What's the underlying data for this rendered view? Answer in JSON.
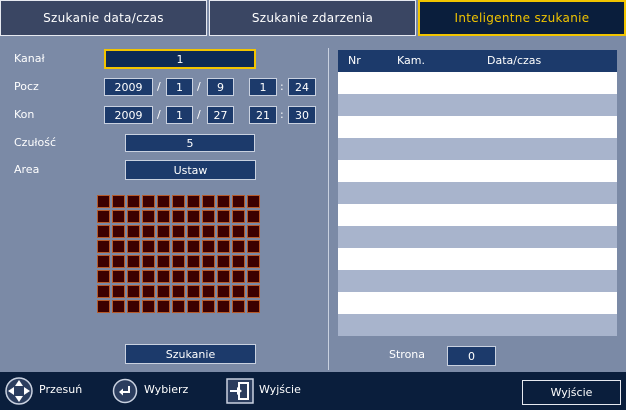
{
  "tabs": [
    {
      "label": "Szukanie data/czas",
      "active": false
    },
    {
      "label": "Szukanie zdarzenia",
      "active": false
    },
    {
      "label": "Inteligentne szukanie",
      "active": true
    }
  ],
  "form": {
    "channel_label": "Kanał",
    "channel_value": "1",
    "start_label": "Pocz",
    "start": {
      "year": "2009",
      "month": "1",
      "day": "9",
      "hour": "1",
      "minute": "24"
    },
    "end_label": "Kon",
    "end": {
      "year": "2009",
      "month": "1",
      "day": "27",
      "hour": "21",
      "minute": "30"
    },
    "date_sep": "/",
    "time_sep": ":",
    "sensitivity_label": "Czułość",
    "sensitivity_value": "5",
    "area_label": "Area",
    "area_button": "Ustaw",
    "area_grid": {
      "cols": 11,
      "rows": 8
    },
    "search_button": "Szukanie"
  },
  "results": {
    "columns": [
      "Nr",
      "Kam.",
      "Data/czas"
    ],
    "row_count": 12,
    "page_label": "Strona",
    "page_value": "0"
  },
  "footer": {
    "move_label": "Przesuń",
    "select_label": "Wybierz",
    "exit_label": "Wyjście",
    "exit_button": "Wyjście"
  },
  "colors": {
    "background": "#7b8aa6",
    "field": "#1c3a6b",
    "accent": "#f1c400",
    "footer": "#0a1e3c",
    "grid_cell": "#3b0000"
  }
}
